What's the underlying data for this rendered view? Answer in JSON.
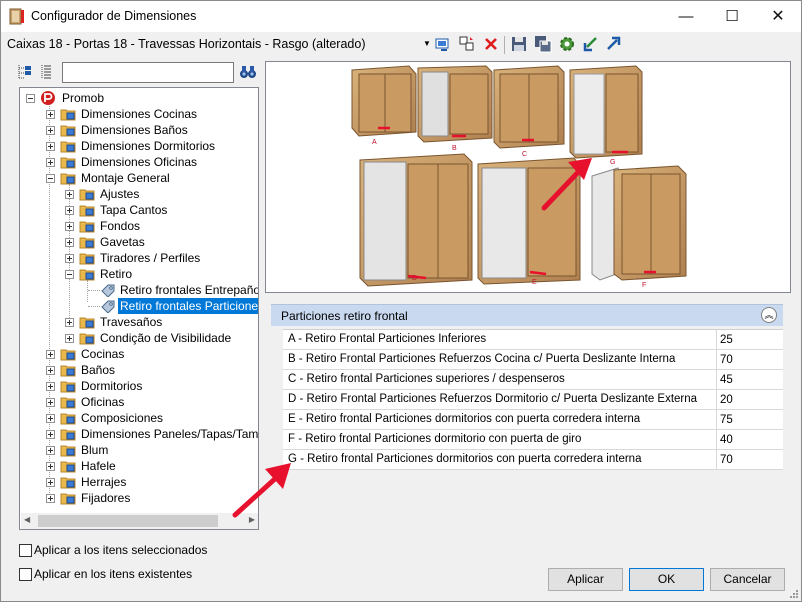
{
  "window": {
    "title": "Configurador de Dimensiones",
    "controls": [
      "—",
      "☐",
      "✕"
    ]
  },
  "toolbar": {
    "dropdown_value": "Caixas 18 - Portas 18 - Travessas Horizontais - Rasgo (alterado)"
  },
  "search": {
    "value": ""
  },
  "tree": {
    "root": "Promob",
    "items": [
      "Dimensiones Cocinas",
      "Dimensiones Baños",
      "Dimensiones Dormitorios",
      "Dimensiones Oficinas",
      "Montaje General",
      "Ajustes",
      "Tapa Cantos",
      "Fondos",
      "Gavetas",
      "Tiradores / Perfiles",
      "Retiro",
      "Retiro frontales Entrepaño",
      "Retiro frontales Particiones",
      "Travesaños",
      "Condição de Visibilidade",
      "Cocinas",
      "Baños",
      "Dormitorios",
      "Oficinas",
      "Composiciones",
      "Dimensiones Paneles/Tapas/Tambu",
      "Blum",
      "Hafele",
      "Herrajes",
      "Fijadores"
    ]
  },
  "preview": {
    "labels": [
      "A",
      "B",
      "C",
      "G",
      "D",
      "E",
      "F"
    ],
    "accent_color": "#e8112d"
  },
  "grid": {
    "header": "Particiones retiro frontal",
    "rows": [
      {
        "label": "A - Retiro Frontal Particiones Inferiores",
        "value": "25"
      },
      {
        "label": "B - Retiro Frontal Particiones Refuerzos Cocina  c/ Puerta Deslizante Interna",
        "value": "70"
      },
      {
        "label": "C - Retiro frontal Particiones superiores / despenseros",
        "value": "45"
      },
      {
        "label": "D - Retiro Frontal Particiones Refuerzos Dormitorio c/ Puerta Deslizante Externa",
        "value": "20"
      },
      {
        "label": "E - Retiro frontal Particiones dormitorios con puerta corredera interna",
        "value": "75"
      },
      {
        "label": "F - Retiro frontal Particiones dormitorio con puerta de giro",
        "value": "40"
      },
      {
        "label": "G - Retiro frontal Particiones dormitorios con puerta corredera interna",
        "value": "70"
      }
    ]
  },
  "options": {
    "apply_selected": "Aplicar a los itens seleccionados",
    "apply_existing": "Aplicar en los itens existentes"
  },
  "buttons": {
    "apply": "Aplicar",
    "ok": "OK",
    "cancel": "Cancelar"
  }
}
